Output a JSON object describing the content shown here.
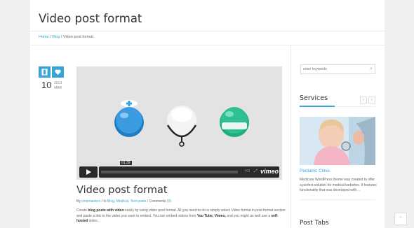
{
  "header": {
    "title": "Video post format"
  },
  "breadcrumb": {
    "home": "Home",
    "sep1": " / ",
    "blog": "Blog",
    "sep2": " / ",
    "current": "Video post format"
  },
  "post": {
    "format_icon": "film-icon",
    "like_icon": "heart-icon",
    "day": "10",
    "year": "2013",
    "month": "MAR",
    "title": "Video post format",
    "meta": {
      "by": "By ",
      "author": "cmsmasters",
      "in": " / In ",
      "cat1": "Blog",
      "c1": ", ",
      "cat2": "Medical",
      "c2": ", ",
      "cat3": "Text posts",
      "sep": " / ",
      "comments": "Comments ",
      "comments_count": "(0)"
    },
    "excerpt": {
      "p1": "Create ",
      "b1": "blog posts with video",
      "p2": " easily by using video post format. All you need to do is simply select Video format in post format section and paste a link to the video you want to embed.  You can embed videos from ",
      "b2": "You Tube, Vimeo,",
      "p3": " and you might as well use a ",
      "b3": "self-hosted",
      "p4": " video."
    }
  },
  "video": {
    "time": "01:39",
    "hd": "HD",
    "brand": "vimeo",
    "play_icon": "play-icon",
    "fullscreen_icon": "fullscreen-icon"
  },
  "sidebar": {
    "search_placeholder": "enter keywords",
    "search_icon": "search-icon",
    "services_title": "Services",
    "prev_icon": "chevron-left-icon",
    "next_icon": "chevron-right-icon",
    "service_link": "Pediatric Clinic",
    "service_desc": "Medicure WordPress theme was created to offer a perfect solution for medical websites. It features functionality that was developed with…",
    "post_tabs_title": "Post Tabs"
  },
  "colors": {
    "accent": "#3aa3d8",
    "dark": "#2a2a2a",
    "teal": "#2fbf94"
  },
  "back_to_top_icon": "chevron-up-icon"
}
